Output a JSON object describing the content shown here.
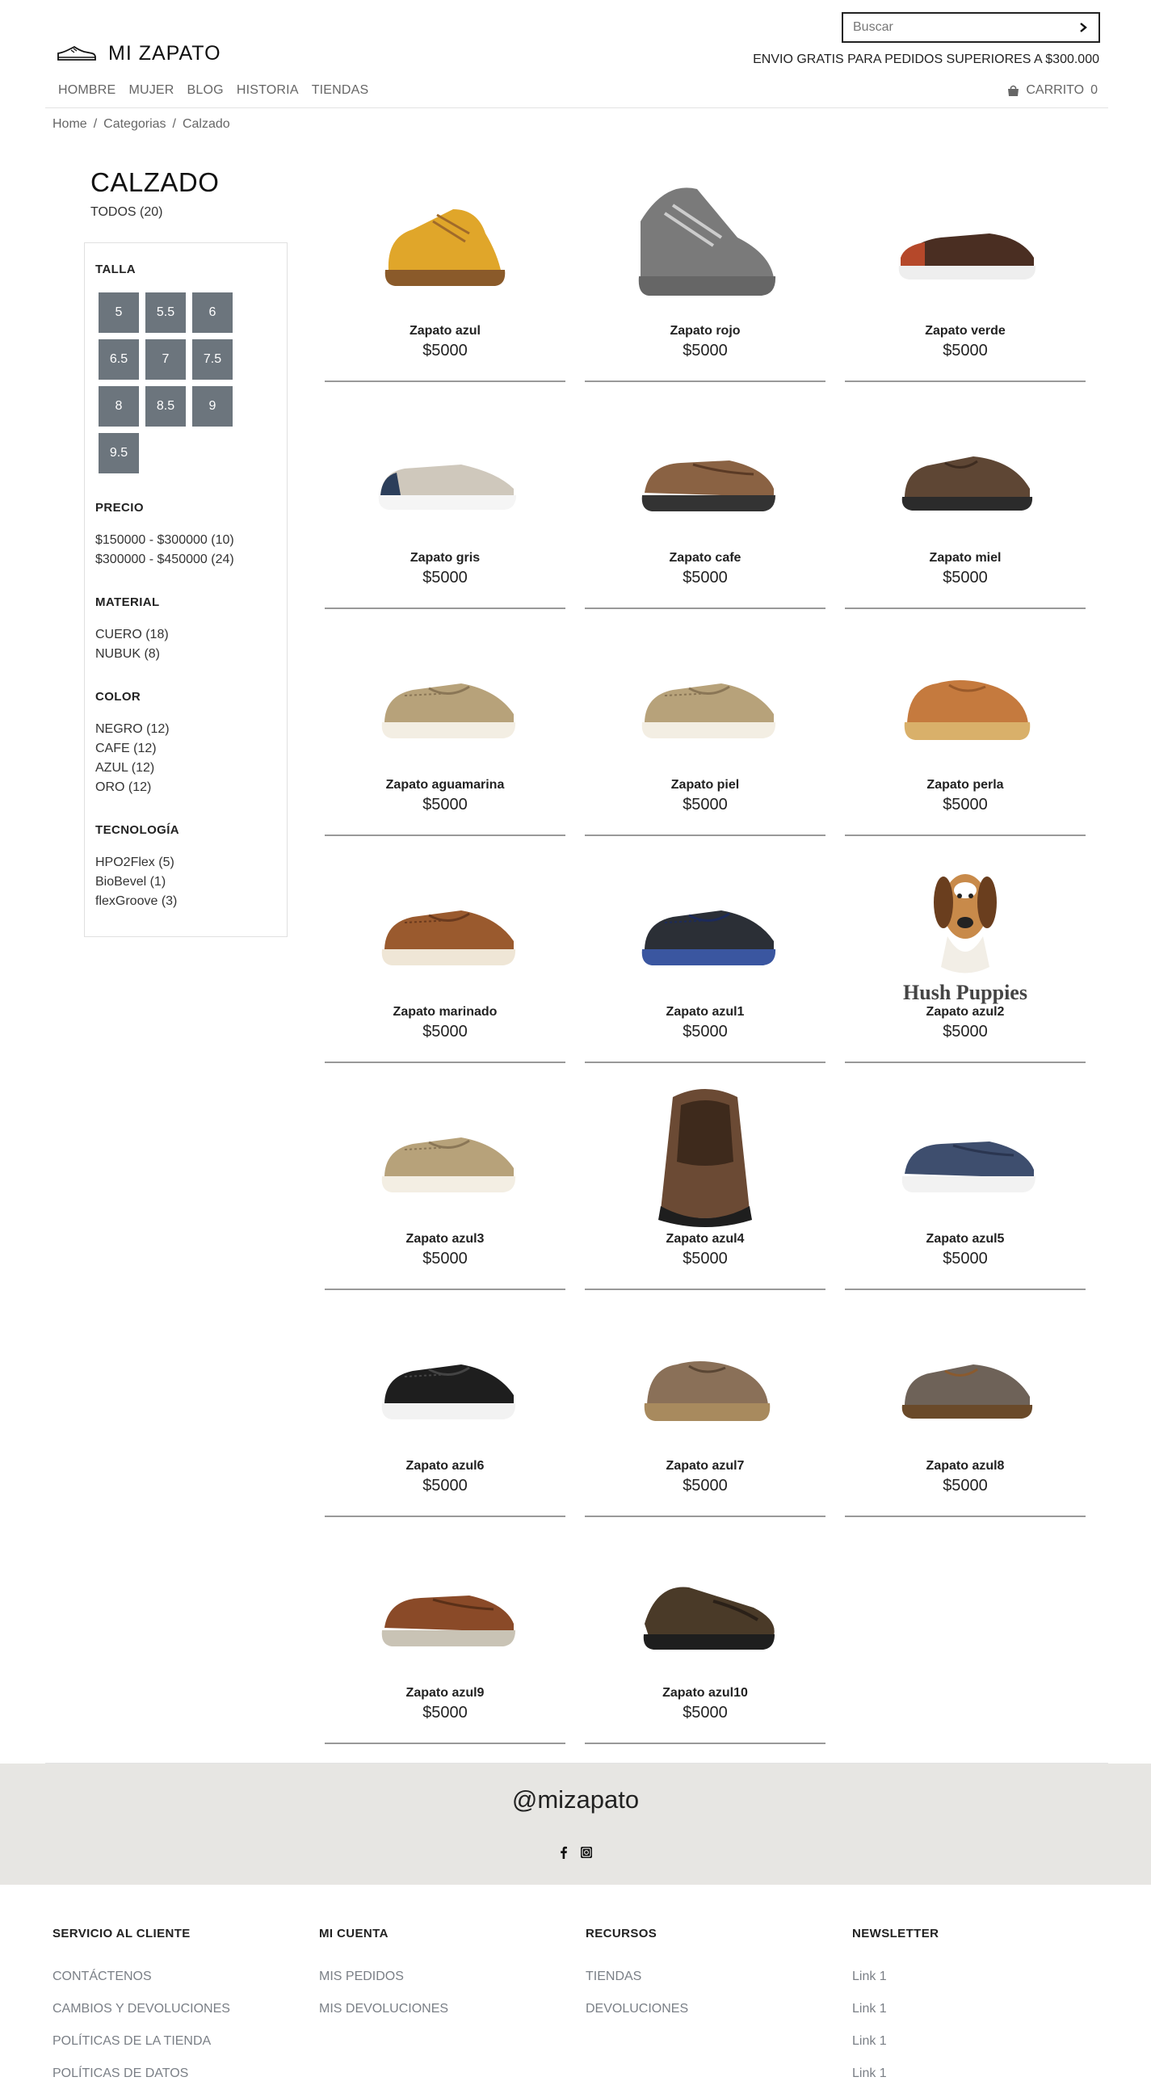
{
  "header": {
    "search_placeholder": "Buscar",
    "logo_text": "MI ZAPATO",
    "shipping": "ENVIO GRATIS PARA PEDIDOS SUPERIORES A $300.000",
    "nav": [
      "HOMBRE",
      "MUJER",
      "BLOG",
      "HISTORIA",
      "TIENDAS"
    ],
    "cart_label": "CARRITO",
    "cart_count": "0"
  },
  "breadcrumb": {
    "home": "Home",
    "sep": "/",
    "categories": "Categorias",
    "current": "Calzado"
  },
  "category": {
    "title": "CALZADO",
    "all": "TODOS (20)"
  },
  "filters": {
    "size_title": "TALLA",
    "sizes": [
      "5",
      "5.5",
      "6",
      "6.5",
      "7",
      "7.5",
      "8",
      "8.5",
      "9",
      "9.5"
    ],
    "price_title": "PRECIO",
    "prices": [
      "$150000 - $300000 (10)",
      "$300000 - $450000 (24)"
    ],
    "material_title": "MATERIAL",
    "materials": [
      "CUERO (18)",
      "NUBUK (8)"
    ],
    "color_title": "COLOR",
    "colors": [
      "NEGRO (12)",
      "CAFE (12)",
      "AZUL (12)",
      "ORO (12)"
    ],
    "tech_title": "TECNOLOGÍA",
    "techs": [
      "HPO2Flex (5)",
      "BioBevel (1)",
      "flexGroove (3)"
    ]
  },
  "products": [
    {
      "name": "Zapato azul",
      "price": "$5000"
    },
    {
      "name": "Zapato rojo",
      "price": "$5000"
    },
    {
      "name": "Zapato verde",
      "price": "$5000"
    },
    {
      "name": "Zapato gris",
      "price": "$5000"
    },
    {
      "name": "Zapato cafe",
      "price": "$5000"
    },
    {
      "name": "Zapato miel",
      "price": "$5000"
    },
    {
      "name": "Zapato aguamarina",
      "price": "$5000"
    },
    {
      "name": "Zapato piel",
      "price": "$5000"
    },
    {
      "name": "Zapato perla",
      "price": "$5000"
    },
    {
      "name": "Zapato marinado",
      "price": "$5000"
    },
    {
      "name": "Zapato azul1",
      "price": "$5000"
    },
    {
      "name": "Zapato azul2",
      "price": "$5000"
    },
    {
      "name": "Zapato azul3",
      "price": "$5000"
    },
    {
      "name": "Zapato azul4",
      "price": "$5000"
    },
    {
      "name": "Zapato azul5",
      "price": "$5000"
    },
    {
      "name": "Zapato azul6",
      "price": "$5000"
    },
    {
      "name": "Zapato azul7",
      "price": "$5000"
    },
    {
      "name": "Zapato azul8",
      "price": "$5000"
    },
    {
      "name": "Zapato azul9",
      "price": "$5000"
    },
    {
      "name": "Zapato azul10",
      "price": "$5000"
    }
  ],
  "brand_logo_text": "Hush Puppies",
  "social": {
    "handle": "@mizapato",
    "icons": [
      "facebook-icon",
      "instagram-icon"
    ]
  },
  "footer": {
    "customer_title": "SERVICIO AL CLIENTE",
    "customer_links": [
      "CONTÁCTENOS",
      "CAMBIOS Y DEVOLUCIONES",
      "POLÍTICAS DE LA TIENDA",
      "POLÍTICAS DE DATOS"
    ],
    "account_title": "MI CUENTA",
    "account_links": [
      "MIS PEDIDOS",
      "MIS DEVOLUCIONES"
    ],
    "resources_title": "RECURSOS",
    "resources_links": [
      "TIENDAS",
      "DEVOLUCIONES"
    ],
    "newsletter_title": "NEWSLETTER",
    "newsletter_links": [
      "Link 1",
      "Link 1",
      "Link 1",
      "Link 1"
    ]
  },
  "colors": {
    "size_button": "#6c757d",
    "social_band": "#e7e6e3",
    "footer_link": "#7a7f86"
  }
}
